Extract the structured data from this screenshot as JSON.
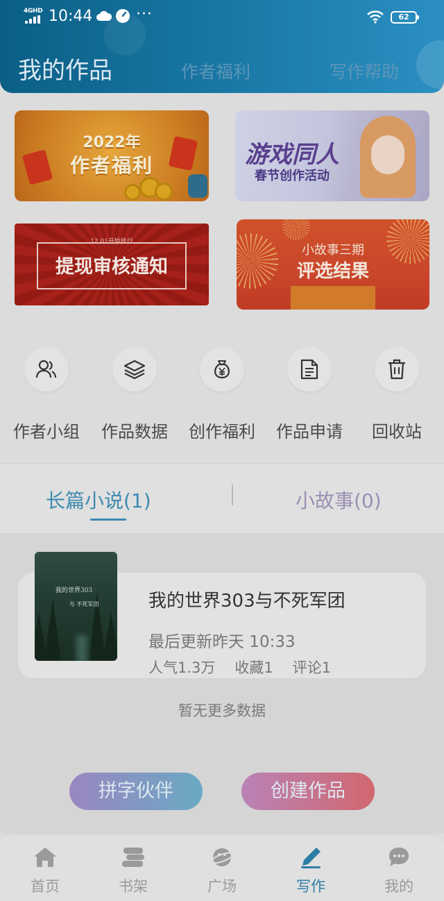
{
  "status_bar": {
    "network": "4GHD",
    "time": "10:44",
    "battery": "62"
  },
  "header": {
    "tabs": [
      {
        "label": "我的作品",
        "active": true
      },
      {
        "label": "作者福利",
        "active": false
      },
      {
        "label": "写作帮助",
        "active": false
      }
    ]
  },
  "banners": {
    "welfare": {
      "year": "2022年",
      "title": "作者福利"
    },
    "game_fan": {
      "title": "游戏同人",
      "subtitle": "春节创作活动"
    },
    "withdraw": {
      "small": "12.01开始执行",
      "title": "提现审核通知"
    },
    "story": {
      "small": "小故事三期",
      "title": "评选结果"
    }
  },
  "quick_actions": [
    {
      "label": "作者小组",
      "icon": "group-icon"
    },
    {
      "label": "作品数据",
      "icon": "layers-icon"
    },
    {
      "label": "创作福利",
      "icon": "money-bag-icon"
    },
    {
      "label": "作品申请",
      "icon": "document-icon"
    },
    {
      "label": "回收站",
      "icon": "trash-icon"
    }
  ],
  "works_tabs": [
    {
      "label": "长篇小说(1)",
      "active": true
    },
    {
      "label": "小故事(0)",
      "active": false
    }
  ],
  "book": {
    "title": "我的世界303与不死军团",
    "updated": "最后更新昨天 10:33",
    "popularity": "人气1.3万",
    "favorites": "收藏1",
    "comments": "评论1",
    "cover_line1": "我的世界303",
    "cover_line2": "与 不死军团"
  },
  "empty_note": "暂无更多数据",
  "buttons": {
    "partner": "拼字伙伴",
    "create": "创建作品"
  },
  "bottom_nav": [
    {
      "label": "首页",
      "icon": "home-icon",
      "active": false
    },
    {
      "label": "书架",
      "icon": "bookshelf-icon",
      "active": false
    },
    {
      "label": "广场",
      "icon": "planet-icon",
      "active": false
    },
    {
      "label": "写作",
      "icon": "pen-icon",
      "active": true
    },
    {
      "label": "我的",
      "icon": "chat-icon",
      "active": false
    }
  ],
  "colors": {
    "header_start": "#0b5f86",
    "header_end": "#2b8fc2",
    "accent": "#3c8ab0",
    "active_nav": "#2d7ea6"
  }
}
